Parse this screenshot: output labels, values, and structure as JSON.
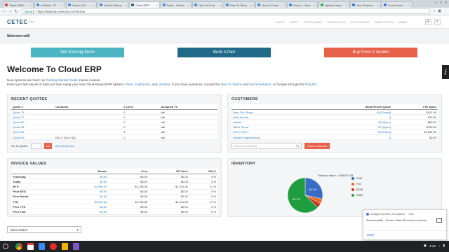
{
  "browser": {
    "tabs": [
      {
        "label": "Ticket #630:",
        "color": "#d44"
      },
      {
        "label": "asTicket : Sl",
        "color": "#4a90e2"
      },
      {
        "label": "How to 2.0",
        "color": "#4a90e2"
      },
      {
        "label": "How to Videos",
        "color": "#4a90e2"
      },
      {
        "label": "Cetec ERP",
        "color": "#2d5a7b",
        "active": true
      },
      {
        "label": "Parts - Versio",
        "color": "#4a90e2"
      },
      {
        "label": "How To Crea",
        "color": "#4a90e2"
      },
      {
        "label": "How To Shop",
        "color": "#4a90e2"
      },
      {
        "label": "How to Curse",
        "color": "#4a90e2"
      },
      {
        "label": "How to - docs",
        "color": "#4a90e2"
      },
      {
        "label": "Upload comp",
        "color": "#34a853"
      },
      {
        "label": "Your Screenc",
        "color": "#3b78e7"
      },
      {
        "label": "Your Screen",
        "color": "#3b78e7"
      }
    ],
    "secure_label": "Secure",
    "url": "https://training.cetecerp.com/home"
  },
  "app": {
    "logo": "CETEC",
    "logo_sub": "ERP",
    "nav": [
      "SALES",
      "PARTS",
      "PURCHASING",
      "WAREHOUSE",
      "ACCOUNTING",
      "PRODUCTION",
      "ADMIN"
    ],
    "welcome_bar": "Welcome will!"
  },
  "actions": {
    "sell": "Sell Existing Stock",
    "build": "Build A Part",
    "buy": "Buy From A Vendor"
  },
  "page": {
    "title": "Welcome To Cloud ERP",
    "intro1_pre": "New systems are hard; our ",
    "intro1_link": "Getting Started Guide",
    "intro1_post": " makes it easier.",
    "intro2_pre": "Enter your first pieces of data and start using your new Cloud-Based ERP System: ",
    "intro2_parts": "Parts",
    "intro2_sep1": ", ",
    "intro2_customers": "Customers",
    "intro2_sep2": ", and ",
    "intro2_vendors": "Vendors",
    "intro2_mid": ". If you have questions, consult the ",
    "intro2_videos": "How To Videos",
    "intro2_and": " and ",
    "intro2_docs": "Documentation",
    "intro2_tail": ", or browse through the ",
    "intro2_faq": "FAQ list",
    "intro2_end": ".",
    "help_tab": "Help"
  },
  "quotes": {
    "title": "RECENT QUOTES",
    "headers": [
      "Quote #",
      "Customer",
      "# Lines",
      "Assigned To"
    ],
    "rows": [
      [
        "Quote 71",
        "",
        "0",
        "will"
      ],
      [
        "Quote 70",
        "",
        "0",
        "will"
      ],
      [
        "Quote 69",
        "",
        "0",
        "will"
      ],
      [
        "Quote 68",
        "",
        "0",
        "will"
      ],
      [
        "Quote 66",
        "",
        "1",
        "will"
      ],
      [
        "Quote 63",
        "DILLY DILLY (3)",
        "0",
        "will"
      ]
    ],
    "go_to_label": "Go To Quote:",
    "go_label": "Go",
    "view_all": "View All Quotes"
  },
  "customers": {
    "title": "CUSTOMERS",
    "headers": [
      "",
      "Most Recent Quote",
      "YTD Sales"
    ],
    "rows": [
      [
        "Bass Pro Shops",
        "59 (Closed)",
        "$421.00"
      ],
      [
        "Willy Wonka",
        "()",
        "$15.00"
      ],
      [
        "staples",
        "55 (Open)",
        "$66.00"
      ],
      [
        "Office Depot",
        "51 (Open)",
        "$750.00"
      ],
      [
        "DILLY DILLY",
        "5 (Closed)",
        "$1,894.00"
      ],
      [
        "Walden neighborhood",
        "()",
        "$0.00"
      ]
    ],
    "search_placeholder": "Search Customers",
    "show_label": "Show Customer"
  },
  "invoices": {
    "title": "INVOICE VALUES",
    "headers": [
      "",
      "Resale",
      "Cost",
      "GP Value",
      "GM %"
    ],
    "rows": [
      [
        "Yesterday",
        "",
        "$0.00",
        "$0.00",
        "$0.00",
        "0 %"
      ],
      [
        "Today",
        "",
        "$0.00",
        "$0.00",
        "$0.00",
        "0 %"
      ],
      [
        "MTD",
        "",
        "$2,990.00",
        "$1,756.50",
        "$1,231.50",
        "41 %"
      ],
      [
        "Prior MTD",
        "",
        "$0.00",
        "$0.00",
        "$0.00",
        "0 %"
      ],
      [
        "Prior Month",
        "",
        "$0.00",
        "$0.00",
        "$0.00",
        "0 %"
      ],
      [
        "YTD",
        "",
        "$2,990.00",
        "$1,756.50",
        "$1,231.50",
        "41 %"
      ],
      [
        "Prior YTD",
        "",
        "$0.00",
        "$0.00",
        "$0.00",
        "0 %"
      ],
      [
        "Prior Year",
        "",
        "$0.00",
        "$0.00",
        "$0.00",
        "0 %"
      ]
    ]
  },
  "inventory": {
    "title": "INVENTORY",
    "total_label": "Total Inv Value = $28,923.25",
    "slices": [
      {
        "name": "SUB",
        "pct": 28.4,
        "label": "28.4%",
        "color": "#3a6cc6"
      },
      {
        "name": "FIG",
        "pct": 4.5,
        "label": "",
        "color": "#e86b1f"
      },
      {
        "name": "BOM",
        "pct": 4.4,
        "label": "",
        "color": "#c0392b"
      },
      {
        "name": "RAW",
        "pct": 62.7,
        "label": "62.7%",
        "color": "#1e9e3e"
      }
    ]
  },
  "add_content": "Add Content",
  "notification": {
    "source": "Google Chrome OS system",
    "time": "now",
    "text": "Screencastify - Screen Video Recorder is sharin...",
    "stop": "STOP"
  },
  "shelf": {
    "time": "4:43"
  }
}
